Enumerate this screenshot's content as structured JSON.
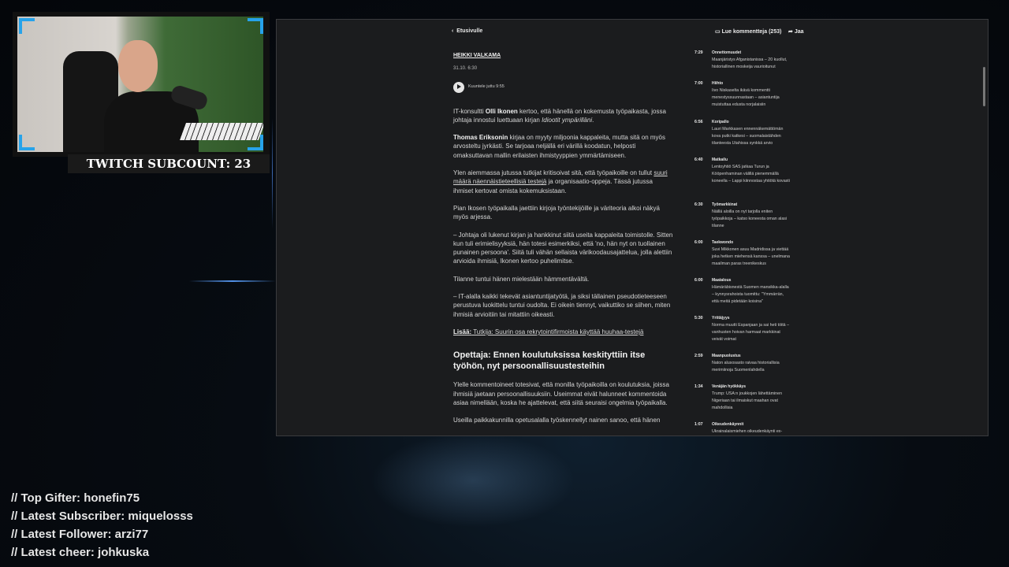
{
  "overlay": {
    "subcount": "TWITCH SUBCOUNT: 23",
    "stats": [
      "// Top Gifter: honefin75",
      "// Latest Subscriber: miquelosss",
      "// Latest Follower: arzi77",
      "// Latest cheer: johkuska"
    ]
  },
  "browser": {
    "back_label": "Etusivulle",
    "comments_label": "Lue kommentteja (253)",
    "share_label": "Jaa"
  },
  "article": {
    "author": "HEIKKI VALKAMA",
    "date": "31.10. 6:30",
    "listen_label": "Kuuntele juttu 9:55",
    "p1_a": "IT-konsultti ",
    "p1_name": "Olli Ikonen",
    "p1_b": " kertoo, että hänellä on kokemusta työpaikasta, jossa johtaja innostui luettuaan kirjan ",
    "p1_book": "Idiootit ympärilläni",
    "p1_c": ".",
    "p2_name": "Thomas Eriksonin",
    "p2_b": " kirjaa on myyty miljoonia kappaleita, mutta sitä on myös arvosteltu jyrkästi. Se tarjoaa neljällä eri värillä koodatun, helposti omaksuttavan mallin erilaisten ihmistyyppien ymmärtämiseen.",
    "p3_a": "Ylen aiemmassa jutussa tutkijat kritisoivat sitä, että työpaikoille on tullut ",
    "p3_link": "suuri määrä näennäistieteellisiä testejä",
    "p3_b": " ja organisaatio-oppeja. Tässä jutussa ihmiset kertovat omista kokemuksistaan.",
    "p4": "Pian Ikosen työpaikalla jaettiin kirjoja työntekijöille ja väriteoria alkoi näkyä myös arjessa.",
    "p5": "– Johtaja oli lukenut kirjan ja hankkinut siitä useita kappaleita toimistolle. Sitten kun tuli erimielisyyksiä, hän totesi esimerkiksi, että 'no, hän nyt on tuollainen punainen persoona'. Siitä tuli vähän sellaista värikoodausajattelua, jolla alettiin arvioida ihmisiä, Ikonen kertoo puhelimitse.",
    "p6": "Tilanne tuntui hänen mielestään hämmentävältä.",
    "p7": "– IT-alalla kaikki tekevät asiantuntijatyötä, ja siksi tällainen pseudotieteeseen perustuva luokittelu tuntui oudolta. Ei oikein tiennyt, vaikuttiko se siihen, miten ihmisiä arvioitiin tai mitattiin oikeasti.",
    "p8_label": "Lisää:",
    "p8_link": " Tutkija: Suurin osa rekrytointifirmoista käyttää huuhaa-testejä",
    "heading": "Opettaja: Ennen koulutuksissa keskityttiin itse työhön, nyt persoonallisuustesteihin",
    "p9": "Ylelle kommentoineet totesivat, että monilla työpaikoilla on koulutuksia, joissa ihmisiä jaetaan persoonallisuuksiin. Useimmat eivät halunneet kommentoida asiaa nimellään, koska he ajattelevat, että siitä seuraisi ongelmia työpaikalla.",
    "p10": "Useilla paikkakunnilla opetusalalla työskennellyt nainen sanoo, että hänen"
  },
  "feed": [
    {
      "time": "7:29",
      "cat": "Onnettomuudet",
      "text": "Maanjäristys Afganistanissa – 20 kuollut, historiallinen moskeija vaurioitunut"
    },
    {
      "time": "7:00",
      "cat": "Hiihto",
      "text": "Iivo Niskaselta ikävä kommentti menestyssuunnastaan – asiantuntija muistuttaa edusta norjalaisiin"
    },
    {
      "time": "6:56",
      "cat": "Koripallo",
      "text": "Lauri Markkasen ennennäkemättömän kova putki katkesi – suomalaistähden tilanteesta Utahissa synkkä arvio"
    },
    {
      "time": "6:40",
      "cat": "Matkailu",
      "text": "Lentoyhtiö SAS jatkaa Turun ja Kööpenhaminan välillä pienemmällä koneella – Lappi kiinnostaa yhtiötä kovasti"
    },
    {
      "time": "6:30",
      "cat": "Työmarkkinat",
      "text": "Näillä aloilla on nyt tarjolla eniten työpaikkoja – katso koneesta oman alasi tilanne"
    },
    {
      "time": "6:00",
      "cat": "Taekwondo",
      "text": "Suvi Mikkonen asuu Madridissa ja viettää joka hetken miehensä kanssa – unelmana maailman paras treenikeskus"
    },
    {
      "time": "6:00",
      "cat": "Maatalous",
      "text": "Hämäräbisnestä Suomen mansikka-alalla – kynnysrahoista tuomittu: \"Ymmärrän, että meitä pidetään koisina\""
    },
    {
      "time": "5:30",
      "cat": "Yrittäjyys",
      "text": "Norma muutti Espanjaan ja sai heti töitä – vanhusten hoivan harmaat markkinat veivät voimat"
    },
    {
      "time": "2:59",
      "cat": "Maanpuolustus",
      "text": "Naton alusosasto raivaa historiallisia merimiinoja Suomenlahdella"
    },
    {
      "time": "1:34",
      "cat": "Venäjän hyökkäys",
      "text": "Trump: USA:n joukkojen lähettäminen Nigeriaan tai ilmaiskut maahan ovat mahdollisia"
    },
    {
      "time": "1:07",
      "cat": "Oikeudenkäynnit",
      "text": "Ukrainalaismiehen oikeudenkäynti ex-"
    }
  ],
  "colors": {
    "accent": "#27a3ea",
    "page_bg": "#1b1c1e"
  }
}
